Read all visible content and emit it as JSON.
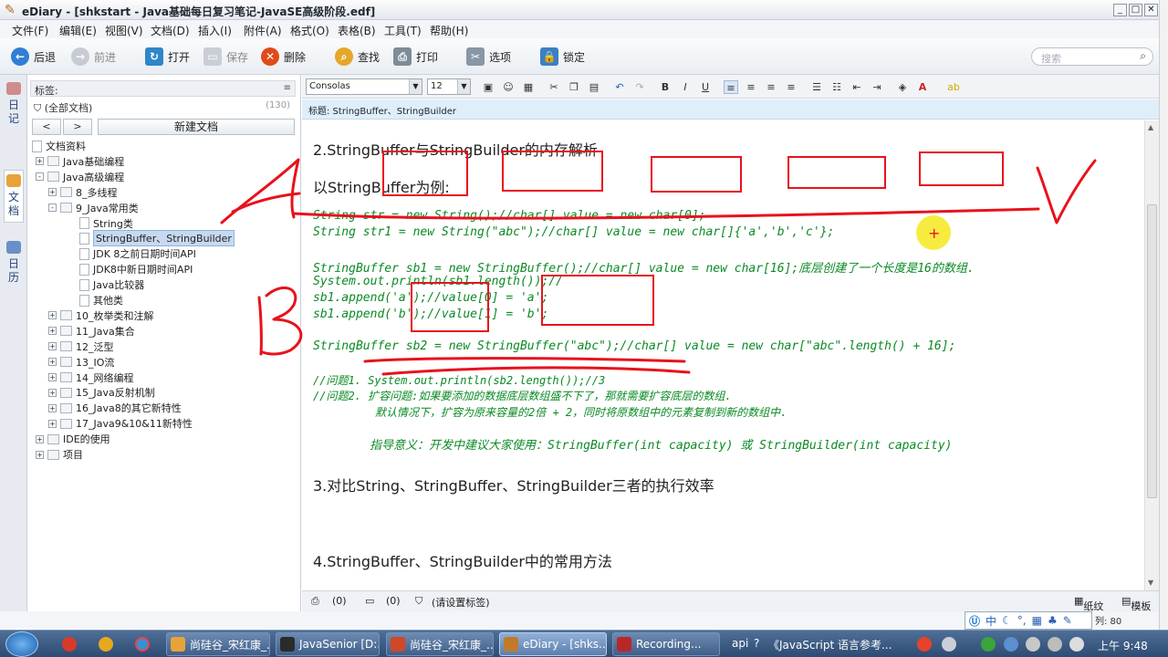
{
  "window": {
    "title": "eDiary - [shkstart - Java基础每日复习笔记-JavaSE高级阶段.edf]",
    "controls": [
      "_",
      "□",
      "✕"
    ]
  },
  "menu": [
    "文件(F)",
    "编辑(E)",
    "视图(V)",
    "文档(D)",
    "插入(I)",
    "附件(A)",
    "格式(O)",
    "表格(B)",
    "工具(T)",
    "帮助(H)"
  ],
  "toolbar": {
    "back": "后退",
    "forward": "前进",
    "open": "打开",
    "save": "保存",
    "delete": "删除",
    "find": "查找",
    "print": "打印",
    "options": "选项",
    "lock": "锁定",
    "search_placeholder": "搜索"
  },
  "vtabs": {
    "diary": "日记",
    "docs": "文档",
    "calendar": "日历"
  },
  "sidebar": {
    "tags_label": "标签:",
    "all_docs": "(全部文档)",
    "all_docs_count": "(130)",
    "nav_back": "<",
    "nav_forward": ">",
    "new_doc": "新建文档",
    "tree": [
      {
        "label": "文档资料",
        "level": 0,
        "type": "root"
      },
      {
        "label": "Java基础编程",
        "level": 1,
        "type": "folder",
        "exp": "+"
      },
      {
        "label": "Java高级编程",
        "level": 1,
        "type": "folder",
        "exp": "-"
      },
      {
        "label": "8_多线程",
        "level": 2,
        "type": "folder",
        "exp": "+"
      },
      {
        "label": "9_Java常用类",
        "level": 2,
        "type": "folder",
        "exp": "-"
      },
      {
        "label": "String类",
        "level": 3,
        "type": "page"
      },
      {
        "label": "StringBuffer、StringBuilder",
        "level": 3,
        "type": "page",
        "selected": true
      },
      {
        "label": "JDK 8之前日期时间API",
        "level": 3,
        "type": "page"
      },
      {
        "label": "JDK8中新日期时间API",
        "level": 3,
        "type": "page"
      },
      {
        "label": "Java比较器",
        "level": 3,
        "type": "page"
      },
      {
        "label": "其他类",
        "level": 3,
        "type": "page"
      },
      {
        "label": "10_枚举类和注解",
        "level": 2,
        "type": "folder",
        "exp": "+"
      },
      {
        "label": "11_Java集合",
        "level": 2,
        "type": "folder",
        "exp": "+"
      },
      {
        "label": "12_泛型",
        "level": 2,
        "type": "folder",
        "exp": "+"
      },
      {
        "label": "13_IO流",
        "level": 2,
        "type": "folder",
        "exp": "+"
      },
      {
        "label": "14_网络编程",
        "level": 2,
        "type": "folder",
        "exp": "+"
      },
      {
        "label": "15_Java反射机制",
        "level": 2,
        "type": "folder",
        "exp": "+"
      },
      {
        "label": "16_Java8的其它新特性",
        "level": 2,
        "type": "folder",
        "exp": "+"
      },
      {
        "label": "17_Java9&10&11新特性",
        "level": 2,
        "type": "folder",
        "exp": "+"
      },
      {
        "label": "IDE的使用",
        "level": 1,
        "type": "folder",
        "exp": "+"
      },
      {
        "label": "项目",
        "level": 1,
        "type": "folder",
        "exp": "+"
      }
    ]
  },
  "format": {
    "font": "Consolas",
    "size": "12",
    "bold": "B",
    "italic": "I",
    "underline": "U"
  },
  "subject": "标题: StringBuffer、StringBuilder",
  "document": {
    "heading2": "2.StringBuffer与StringBuilder的内存解析",
    "example": "以StringBuffer为例:",
    "code1": "String str = new String();//char[] value = new char[0];",
    "code2": "String str1 = new String(\"abc\");//char[] value = new char[]{'a','b','c'};",
    "code3": "StringBuffer sb1 = new StringBuffer();//char[] value = new char[16];底层创建了一个长度是16的数组.",
    "code4": "System.out.println(sb1.length());//",
    "code5": "sb1.append('a');//value[0] = 'a';",
    "code6": "sb1.append('b');//value[1] = 'b';",
    "code7": "StringBuffer sb2 = new StringBuffer(\"abc\");//char[] value = new char[\"abc\".length() + 16];",
    "comment1": "//问题1. System.out.println(sb2.length());//3",
    "comment2": "//问题2. 扩容问题:如果要添加的数据底层数组盛不下了，那就需要扩容底层的数组.",
    "comment3": "默认情况下，扩容为原来容量的2倍 + 2，同时将原数组中的元素复制到新的数组中.",
    "comment4": "指导意义：开发中建议大家使用：StringBuffer(int capacity) 或 StringBuilder(int capacity)",
    "heading3": "3.对比String、StringBuffer、StringBuilder三者的执行效率",
    "heading4": "4.StringBuffer、StringBuilder中的常用方法"
  },
  "statusbar": {
    "attach_count": "(0)",
    "comment_count": "(0)",
    "tag_hint": "(请设置标签)",
    "paper": "纸纹",
    "template": "模板"
  },
  "ime": {
    "label": "中"
  },
  "col_info": "列: 80",
  "taskbar": {
    "items": [
      {
        "label": "尚硅谷_宋红康_...",
        "color": "#e8a23a"
      },
      {
        "label": "JavaSenior [D:...",
        "color": "#2b2b2b"
      },
      {
        "label": "尚硅谷_宋红康_...",
        "color": "#d24726"
      },
      {
        "label": "eDiary - [shks...",
        "color": "#c07a2a"
      },
      {
        "label": "Recording...",
        "color": "#b8282a"
      }
    ],
    "api_text": "api",
    "js_text": "《JavaScript 语言参考...",
    "clock": "上午 9:48"
  }
}
